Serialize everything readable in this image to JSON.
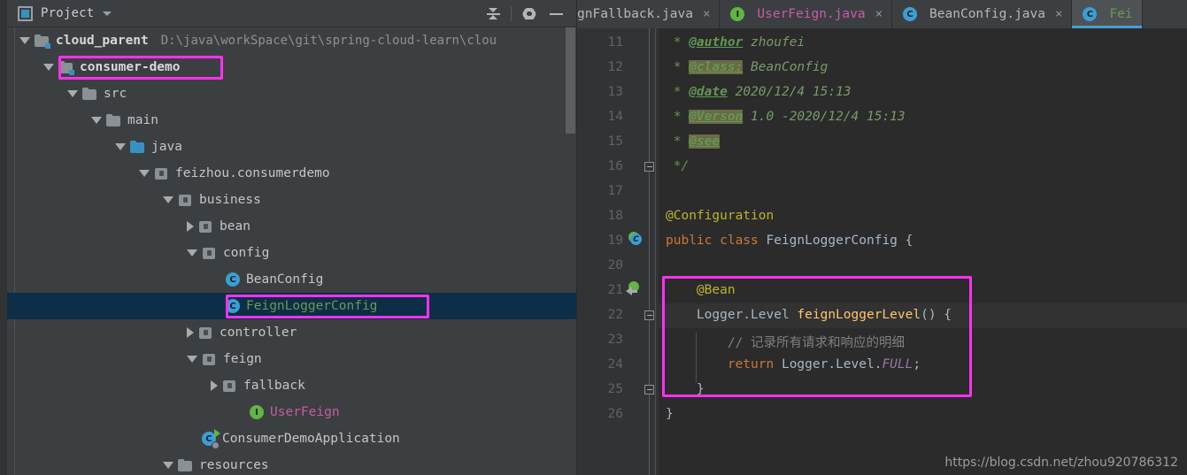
{
  "panel": {
    "title": "Project",
    "icons": {
      "window": "project-window-icon",
      "dropdown": "chevron-down-icon",
      "collapse_all": "collapse-all-icon",
      "settings": "gear-icon",
      "hide": "minimize-icon"
    }
  },
  "tree": {
    "items": [
      {
        "label": "cloud_parent",
        "path": "D:\\java\\workSpace\\git\\spring-cloud-learn\\clou",
        "icon": "module-folder-icon",
        "indent": 0,
        "state": "expanded",
        "style": "bold",
        "highlight": false,
        "selected": false
      },
      {
        "label": "consumer-demo",
        "path": "",
        "icon": "module-folder-icon",
        "indent": 1,
        "state": "expanded",
        "style": "bold",
        "highlight": true,
        "selected": false
      },
      {
        "label": "src",
        "path": "",
        "icon": "folder-icon",
        "indent": 2,
        "state": "expanded",
        "style": "normal",
        "highlight": false,
        "selected": false
      },
      {
        "label": "main",
        "path": "",
        "icon": "folder-icon",
        "indent": 3,
        "state": "expanded",
        "style": "normal",
        "highlight": false,
        "selected": false
      },
      {
        "label": "java",
        "path": "",
        "icon": "source-folder-icon",
        "indent": 4,
        "state": "expanded",
        "style": "normal",
        "highlight": false,
        "selected": false
      },
      {
        "label": "feizhou.consumerdemo",
        "path": "",
        "icon": "package-icon",
        "indent": 5,
        "state": "expanded",
        "style": "normal",
        "highlight": false,
        "selected": false
      },
      {
        "label": "business",
        "path": "",
        "icon": "package-icon",
        "indent": 6,
        "state": "expanded",
        "style": "normal",
        "highlight": false,
        "selected": false
      },
      {
        "label": "bean",
        "path": "",
        "icon": "package-icon",
        "indent": 7,
        "state": "collapsed",
        "style": "normal",
        "highlight": false,
        "selected": false
      },
      {
        "label": "config",
        "path": "",
        "icon": "package-icon",
        "indent": 7,
        "state": "expanded",
        "style": "normal",
        "highlight": false,
        "selected": false
      },
      {
        "label": "BeanConfig",
        "path": "",
        "icon": "java-class-icon",
        "indent": 8,
        "state": "leaf",
        "style": "normal",
        "highlight": false,
        "selected": false
      },
      {
        "label": "FeignLoggerConfig",
        "path": "",
        "icon": "java-class-icon",
        "indent": 8,
        "state": "leaf",
        "style": "green",
        "highlight": true,
        "selected": true
      },
      {
        "label": "controller",
        "path": "",
        "icon": "package-icon",
        "indent": 7,
        "state": "collapsed",
        "style": "normal",
        "highlight": false,
        "selected": false
      },
      {
        "label": "feign",
        "path": "",
        "icon": "package-icon",
        "indent": 7,
        "state": "expanded",
        "style": "normal",
        "highlight": false,
        "selected": false
      },
      {
        "label": "fallback",
        "path": "",
        "icon": "package-icon",
        "indent": 8,
        "state": "collapsed",
        "style": "normal",
        "highlight": false,
        "selected": false
      },
      {
        "label": "UserFeign",
        "path": "",
        "icon": "java-interface-icon",
        "indent": 9,
        "state": "leaf",
        "style": "magenta",
        "highlight": false,
        "selected": false
      },
      {
        "label": "ConsumerDemoApplication",
        "path": "",
        "icon": "spring-boot-run-icon",
        "indent": 7,
        "state": "leaf",
        "style": "normal",
        "highlight": false,
        "selected": false
      },
      {
        "label": "resources",
        "path": "",
        "icon": "resource-folder-icon",
        "indent": 6,
        "state": "expanded",
        "style": "normal",
        "highlight": false,
        "selected": false
      }
    ]
  },
  "editor": {
    "tabs": [
      {
        "label": "gnFallback.java",
        "icon": "none",
        "icon_letter": "",
        "color": "grey",
        "active": false,
        "closable": true,
        "clipped": true
      },
      {
        "label": "UserFeign.java",
        "icon": "java-interface-icon",
        "icon_letter": "I",
        "color": "pink",
        "active": false,
        "closable": true,
        "clipped": false
      },
      {
        "label": "BeanConfig.java",
        "icon": "java-class-icon",
        "icon_letter": "C",
        "color": "grey",
        "active": false,
        "closable": true,
        "clipped": false
      },
      {
        "label": "Fei",
        "icon": "java-class-icon",
        "icon_letter": "C",
        "color": "green",
        "active": true,
        "closable": false,
        "clipped": false
      }
    ],
    "close_glyph": "×",
    "lines": [
      {
        "no": "11",
        "segments": [
          {
            "t": " * ",
            "c": "cm"
          },
          {
            "t": "@author",
            "c": "cm-tag"
          },
          {
            "t": " zhoufei",
            "c": "cm-txt"
          }
        ],
        "gutter_icon": "",
        "fold": ""
      },
      {
        "no": "12",
        "segments": [
          {
            "t": " * ",
            "c": "cm"
          },
          {
            "t": "@class:",
            "c": "cm-tag hlbg"
          },
          {
            "t": " BeanConfig",
            "c": "cm-txt"
          }
        ],
        "gutter_icon": "",
        "fold": ""
      },
      {
        "no": "13",
        "segments": [
          {
            "t": " * ",
            "c": "cm"
          },
          {
            "t": "@date",
            "c": "cm-tag"
          },
          {
            "t": " 2020/12/4 15:13",
            "c": "cm-txt"
          }
        ],
        "gutter_icon": "",
        "fold": ""
      },
      {
        "no": "14",
        "segments": [
          {
            "t": " * ",
            "c": "cm"
          },
          {
            "t": "@Verson",
            "c": "cm-tag hlbg"
          },
          {
            "t": " 1.0 -2020/12/4 15:13",
            "c": "cm-txt"
          }
        ],
        "gutter_icon": "",
        "fold": ""
      },
      {
        "no": "15",
        "segments": [
          {
            "t": " * ",
            "c": "cm"
          },
          {
            "t": "@see",
            "c": "cm-tag hlbg"
          }
        ],
        "gutter_icon": "",
        "fold": ""
      },
      {
        "no": "16",
        "segments": [
          {
            "t": " */",
            "c": "cm"
          }
        ],
        "gutter_icon": "",
        "fold": "end"
      },
      {
        "no": "17",
        "segments": [],
        "gutter_icon": "",
        "fold": ""
      },
      {
        "no": "18",
        "segments": [
          {
            "t": "@Configuration",
            "c": "ann"
          }
        ],
        "gutter_icon": "",
        "fold": ""
      },
      {
        "no": "19",
        "segments": [
          {
            "t": "public class",
            "c": "kw"
          },
          {
            "t": " FeignLoggerConfig {",
            "c": "plain"
          }
        ],
        "gutter_icon": "class-marker-icon",
        "fold": ""
      },
      {
        "no": "20",
        "segments": [],
        "gutter_icon": "",
        "fold": ""
      },
      {
        "no": "21",
        "segments": [
          {
            "t": "    @Bean",
            "c": "ann"
          }
        ],
        "gutter_icon": "bean-override-icon",
        "fold": ""
      },
      {
        "no": "22",
        "segments": [
          {
            "t": "    Logger.Level ",
            "c": "plain"
          },
          {
            "t": "feignLoggerLevel",
            "c": "mth"
          },
          {
            "t": "() {",
            "c": "plain"
          }
        ],
        "gutter_icon": "",
        "fold": "start"
      },
      {
        "no": "23",
        "segments": [
          {
            "t": "        // 记录所有请求和响应的明细",
            "c": "cmt"
          }
        ],
        "gutter_icon": "",
        "fold": ""
      },
      {
        "no": "24",
        "segments": [
          {
            "t": "        ",
            "c": "plain"
          },
          {
            "t": "return",
            "c": "kw"
          },
          {
            "t": " Logger.Level.",
            "c": "plain"
          },
          {
            "t": "FULL",
            "c": "stat"
          },
          {
            "t": ";",
            "c": "plain"
          }
        ],
        "gutter_icon": "",
        "fold": ""
      },
      {
        "no": "25",
        "segments": [
          {
            "t": "    }",
            "c": "plain"
          }
        ],
        "gutter_icon": "",
        "fold": "end"
      },
      {
        "no": "26",
        "segments": [
          {
            "t": "}",
            "c": "plain"
          }
        ],
        "gutter_icon": "",
        "fold": ""
      }
    ],
    "watermark": "https://blog.csdn.net/zhou920786312"
  },
  "colors": {
    "highlight_box": "#ff30f0",
    "selection": "#0d2e46",
    "tab_active_underline": "#4a9ece",
    "editor_bg": "#2b2b2b",
    "panel_bg": "#3c3f41",
    "gutter_bg": "#313335",
    "annotation": "#bbb529",
    "keyword": "#cc7832",
    "method": "#ffc66d",
    "javadoc": "#629755",
    "comment": "#808080",
    "static_field": "#9876aa",
    "class_icon": "#389fd6",
    "interface_icon": "#62b543"
  }
}
